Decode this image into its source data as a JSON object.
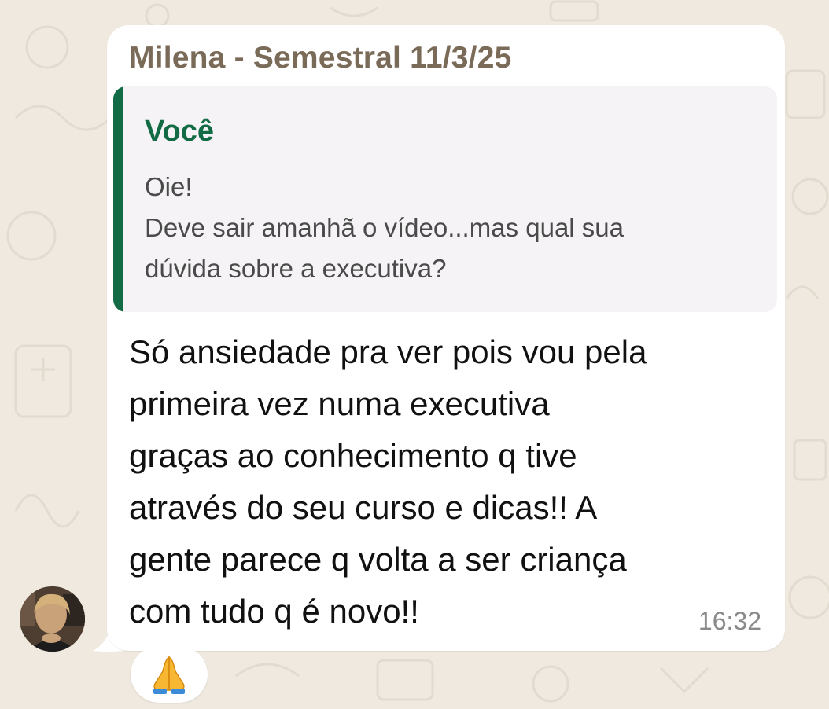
{
  "chat": {
    "sender_header": "Milena - Semestral 11/3/25",
    "quoted": {
      "author": "Você",
      "lines": [
        "Oie!",
        "Deve sair amanhã o vídeo...mas qual sua",
        "dúvida sobre a executiva?"
      ]
    },
    "message": {
      "lines": [
        "Só ansiedade pra ver pois vou pela",
        "primeira vez numa executiva",
        "graças ao conhecimento q tive",
        "através do seu curso e dicas!! A",
        "gente parece q volta a ser criança",
        "com tudo q é novo!!"
      ],
      "time": "16:32"
    },
    "reaction": {
      "icon": "folded-hands-emoji"
    }
  },
  "colors": {
    "background": "#efe9df",
    "bubble": "#ffffff",
    "sender": "#7a6a58",
    "quote_accent": "#136b45",
    "quote_background": "#f5f3f5"
  }
}
